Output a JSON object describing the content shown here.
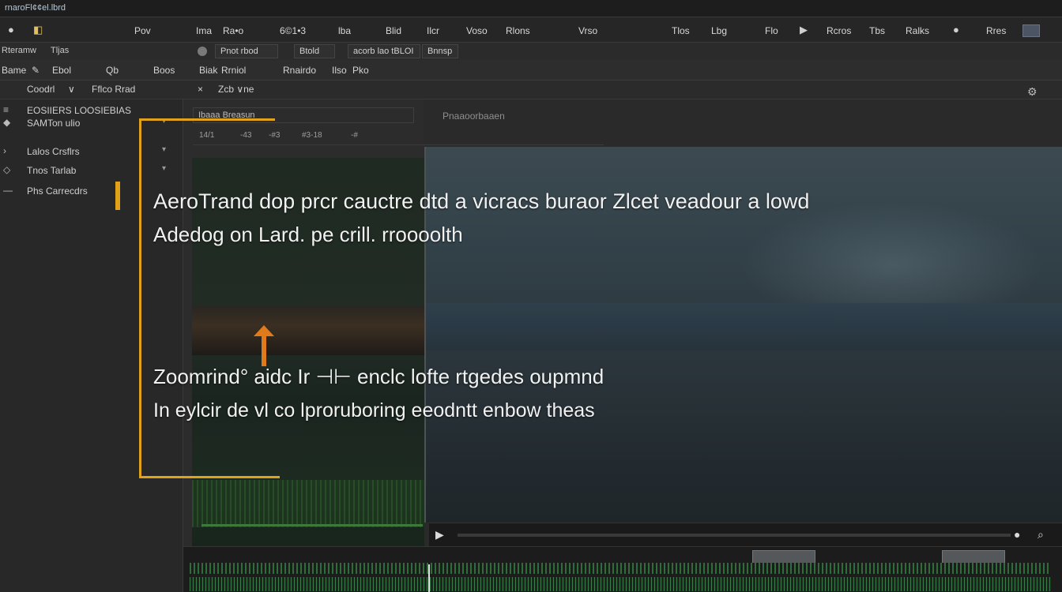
{
  "title_bar": {
    "title": "rnaroFl¢¢el.lbrd"
  },
  "menu": {
    "items": [
      "Pov",
      "Ima",
      "Ra•o",
      "6©1•3",
      "lba",
      "Blid",
      "Ilcr",
      "Voso",
      "Rlons",
      "Vrso",
      "Tlos",
      "Lbg",
      "Flo",
      "Rcros",
      "Tbs",
      "Ralks",
      "Rres"
    ]
  },
  "options_bar": {
    "left_label": "Rteramw",
    "filter_label": "Tljas",
    "field1": "Pnot rbod",
    "field2": "Btold",
    "field3": "acorb lao tBLOI",
    "field4": "Bnnsp"
  },
  "toolbar": {
    "items": [
      "Bame",
      "Ebol",
      "Qb",
      "Boos",
      "Biak",
      "Rrniol",
      "Rnairdo",
      "Ilso",
      "Pko"
    ]
  },
  "panel_bar": {
    "dropdown1": "Coodrl",
    "dropdown2": "Fflco Rrad",
    "dropdown3": "Zcb ∨ne"
  },
  "left_panel": {
    "rows": [
      {
        "icon": "≡",
        "text": "EOSIIERS LOOSIEBIAS"
      },
      {
        "icon": "◆",
        "text": "SAMTon ulio"
      },
      {
        "icon": "›",
        "text": "Lalos Crsflrs"
      },
      {
        "icon": "◇",
        "text": "Tnos Tarlab"
      },
      {
        "icon": "—",
        "text": "Phs Carrecdrs"
      }
    ]
  },
  "center": {
    "header_text": "Ibaaa Breasun",
    "ruler": [
      "14/1",
      "-43",
      "-#3",
      "#3-18",
      "-#"
    ],
    "viewer_label": "Pnaaoorbaaen"
  },
  "overlay_text": {
    "line1": "AeroTrand dop prcr cauctre dtd a vicracs buraor Zlcet veadour a lowd",
    "line2": "Adedog on Lard. pe crill. rroooolth",
    "line3": "Zoomrind° aidc Ir ⊣⊢ enclc lofte rtgedes oupmnd",
    "line4": "In eylcir de vl co lproruboring eeodntt enbow theas"
  },
  "colors": {
    "highlight": "#e0a21a",
    "accent_arrow": "#e07a1a",
    "timeline_green": "#3a7e49"
  },
  "icons": {
    "play": "▶",
    "record": "●",
    "search": "⌕"
  }
}
